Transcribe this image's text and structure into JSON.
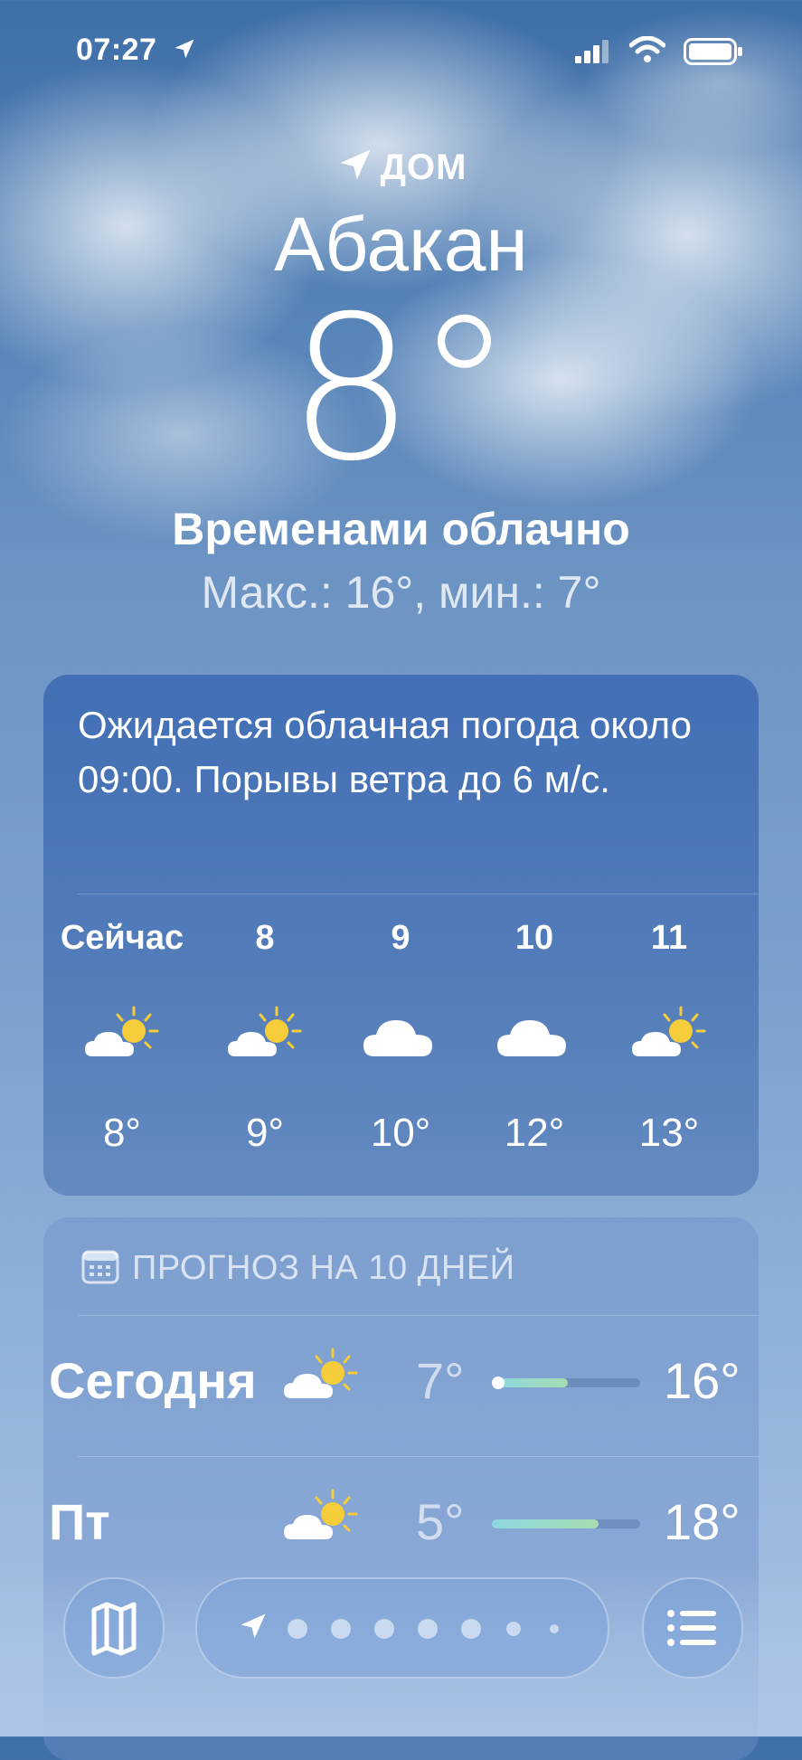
{
  "status_bar": {
    "time": "07:27"
  },
  "location": {
    "label": "ДОМ",
    "city": "Абакан",
    "temperature": "8°",
    "condition": "Временами облачно",
    "hi_lo": "Макс.: 16°, мин.: 7°"
  },
  "hourly_card": {
    "summary": "Ожидается облачная погода около 09:00. Порывы ветра до 6 м/с.",
    "hours": [
      {
        "label": "Сейчас",
        "icon": "partly-sunny-icon",
        "temp": "8°"
      },
      {
        "label": "8",
        "icon": "partly-sunny-icon",
        "temp": "9°"
      },
      {
        "label": "9",
        "icon": "cloud-icon",
        "temp": "10°"
      },
      {
        "label": "10",
        "icon": "cloud-icon",
        "temp": "12°"
      },
      {
        "label": "11",
        "icon": "partly-sunny-icon",
        "temp": "13°"
      }
    ]
  },
  "daily_card": {
    "title": "ПРОГНОЗ НА 10 ДНЕЙ",
    "days": [
      {
        "name": "Сегодня",
        "icon": "partly-sunny-icon",
        "min": "7°",
        "max": "16°",
        "current_marker": true
      },
      {
        "name": "Пт",
        "icon": "partly-sunny-icon",
        "min": "5°",
        "max": "18°",
        "current_marker": false
      }
    ]
  },
  "bottom_bar": {
    "map_button": "map-icon",
    "list_button": "list-icon",
    "page_count": 7,
    "current_page": 1
  },
  "colors": {
    "sun": "#f5cc3a",
    "cloud": "#ffffff",
    "range_start": "#8ed8e0",
    "range_end": "#a6dcb0"
  }
}
